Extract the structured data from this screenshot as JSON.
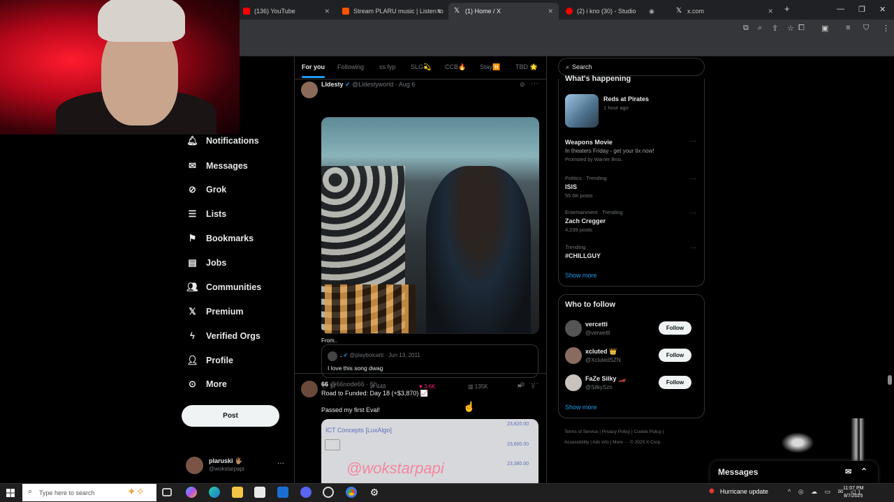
{
  "browser": {
    "tabs": [
      {
        "label": "(136) YouTube",
        "active": false
      },
      {
        "label": "Stream PLARU music | Listen to",
        "active": false
      },
      {
        "label": "(1) Home / X",
        "active": true
      },
      {
        "label": "(2) i kno (30) - Studio",
        "active": false
      },
      {
        "label": "x.com",
        "active": false
      }
    ],
    "new_tab": "+",
    "window_controls": [
      "—",
      "❐",
      "✕"
    ]
  },
  "nav": {
    "items": [
      {
        "label": "Notifications",
        "icon": "bell-icon"
      },
      {
        "label": "Messages",
        "icon": "envelope-icon"
      },
      {
        "label": "Grok",
        "icon": "grok-icon"
      },
      {
        "label": "Lists",
        "icon": "list-icon"
      },
      {
        "label": "Bookmarks",
        "icon": "bookmark-icon"
      },
      {
        "label": "Jobs",
        "icon": "briefcase-icon"
      },
      {
        "label": "Communities",
        "icon": "people-icon"
      },
      {
        "label": "Premium",
        "icon": "x-logo-icon"
      },
      {
        "label": "Verified Orgs",
        "icon": "lightning-icon"
      },
      {
        "label": "Profile",
        "icon": "person-icon"
      },
      {
        "label": "More",
        "icon": "more-circle-icon"
      }
    ],
    "post_label": "Post",
    "account": {
      "name": "plaruski 🖐🏽",
      "handle": "@wokstarpapi",
      "more": "···"
    }
  },
  "feed": {
    "tabs": [
      {
        "label": "For you",
        "active": true
      },
      {
        "label": "Following",
        "active": false
      },
      {
        "label": "ss fyp",
        "active": false
      },
      {
        "label": "SLG💫",
        "active": false
      },
      {
        "label": "CCB🔥",
        "active": false
      },
      {
        "label": "Stay⏸️",
        "active": false
      },
      {
        "label": "TBD 🌟",
        "active": false
      }
    ],
    "post1": {
      "name": "Lldesty",
      "handle": "@Lldestyworld",
      "time": "· Aug 6",
      "caption": "From..",
      "quote": {
        "name": ".",
        "handle": "@playboicarti",
        "time": "· Jun 13, 2011",
        "text": "I love this song dwag"
      },
      "stats": {
        "replies": "17",
        "reposts": "448",
        "likes": "3.6K",
        "views": "135K"
      }
    },
    "post2": {
      "name": "66",
      "handle": "@66node66",
      "time": "· 6h",
      "line1": "Road to Funded: Day 18 (+$3,870) 📈",
      "line2": "Passed my first Eval!",
      "chart_title": "ICT Concepts [LuxAlgo]",
      "price_labels": [
        "23,820.00",
        "23,600.00",
        "23,380.00"
      ]
    },
    "watermark": "@wokstarpapi"
  },
  "sidebar": {
    "search_placeholder": "Search",
    "happening": {
      "title": "What's happening",
      "event": {
        "name": "Reds at Pirates",
        "time": "1 hour ago"
      },
      "promo": {
        "name": "Weapons Movie",
        "desc": "In theaters Friday - get your tix now!",
        "by": "Promoted by Warner Bros."
      },
      "trends": [
        {
          "category": "Politics · Trending",
          "name": "ISIS",
          "posts": "55.6K posts"
        },
        {
          "category": "Entertainment · Trending",
          "name": "Zach Cregger",
          "posts": "4,239 posts"
        },
        {
          "category": "Trending",
          "name": "#CHILLGUY",
          "posts": ""
        }
      ],
      "show_more": "Show more"
    },
    "who_to_follow": {
      "title": "Who to follow",
      "accounts": [
        {
          "name": "vercetti",
          "handle": "@verwetti",
          "button": "Follow"
        },
        {
          "name": "xcluted 👑",
          "handle": "@XclutedSZN",
          "button": "Follow"
        },
        {
          "name": "FaZe Silky 🏎️",
          "handle": "@SilkySzn",
          "button": "Follow"
        }
      ],
      "show_more": "Show more"
    },
    "footer": [
      "Terms of Service",
      "Privacy Policy",
      "Cookie Policy",
      "Accessibility",
      "Ads info",
      "More ···",
      "© 2025 X Corp."
    ]
  },
  "messages_drawer": {
    "title": "Messages"
  },
  "taskbar": {
    "search_placeholder": "Type here to search",
    "weather": "Hurricane update",
    "time": "11:07 PM",
    "date": "8/7/2025"
  }
}
